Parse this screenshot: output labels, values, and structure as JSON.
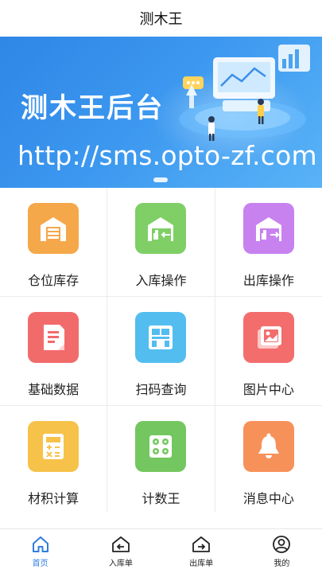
{
  "header": {
    "title": "测木王"
  },
  "banner": {
    "headline": "测木王后台",
    "url": "http://sms.opto-zf.com"
  },
  "menu": {
    "items": [
      {
        "label": "仓位库存",
        "icon": "warehouse-icon",
        "color": "#f5a84a"
      },
      {
        "label": "入库操作",
        "icon": "warehouse-in-icon",
        "color": "#7fcf66"
      },
      {
        "label": "出库操作",
        "icon": "warehouse-out-icon",
        "color": "#c882ef"
      },
      {
        "label": "基础数据",
        "icon": "document-icon",
        "color": "#f26b6b"
      },
      {
        "label": "扫码查询",
        "icon": "scan-icon",
        "color": "#53bdf0"
      },
      {
        "label": "图片中心",
        "icon": "picture-icon",
        "color": "#f36d6d"
      },
      {
        "label": "材积计算",
        "icon": "calculator-icon",
        "color": "#f6c24a"
      },
      {
        "label": "计数王",
        "icon": "counter-icon",
        "color": "#74c760"
      },
      {
        "label": "消息中心",
        "icon": "bell-icon",
        "color": "#f7915a"
      }
    ]
  },
  "tabbar": {
    "active_color": "#2f7de1",
    "items": [
      {
        "label": "首页",
        "icon": "home-icon",
        "active": true
      },
      {
        "label": "入库单",
        "icon": "inbound-order-icon",
        "active": false
      },
      {
        "label": "出库单",
        "icon": "outbound-order-icon",
        "active": false
      },
      {
        "label": "我的",
        "icon": "profile-icon",
        "active": false
      }
    ]
  }
}
